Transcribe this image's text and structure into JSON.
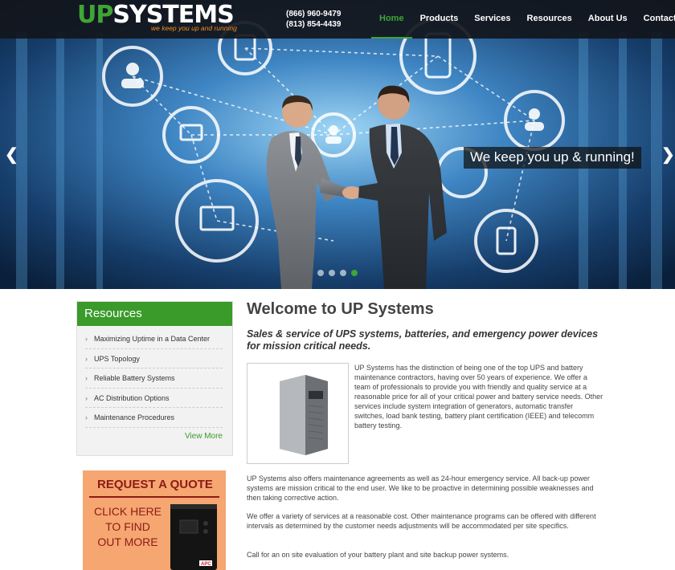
{
  "brand": {
    "logo_up": "UP",
    "logo_systems": "SYSTEMS",
    "tagline": "we keep you up and running",
    "green": "#3fa535",
    "orange": "#f28c1c"
  },
  "contact": {
    "phone1": "(866) 960-9479",
    "phone2": "(813) 854-4439"
  },
  "nav": {
    "items": [
      {
        "label": "Home",
        "active": true
      },
      {
        "label": "Products",
        "active": false
      },
      {
        "label": "Services",
        "active": false
      },
      {
        "label": "Resources",
        "active": false
      },
      {
        "label": "About Us",
        "active": false
      },
      {
        "label": "Contact",
        "active": false
      }
    ]
  },
  "hero": {
    "caption": "We keep you up & running!",
    "prev_icon": "chevron-left-icon",
    "next_icon": "chevron-right-icon",
    "prev_glyph": "❮",
    "next_glyph": "❯",
    "slide_count": 4,
    "active_slide": 4
  },
  "sidebar": {
    "title": "Resources",
    "bullet": "›",
    "items": [
      "Maximizing Uptime in a Data Center",
      "UPS Topology",
      "Reliable Battery Systems",
      "AC Distribution Options",
      "Maintenance Procedures"
    ],
    "view_more": "View More"
  },
  "quote_banner": {
    "title": "REQUEST A QUOTE",
    "line1": "CLICK HERE",
    "line2": "TO FIND",
    "line3": "OUT MORE",
    "device_brand": "APC"
  },
  "main": {
    "title": "Welcome to UP Systems",
    "subtitle": "Sales & service of UPS systems, batteries, and emergency power devices for mission critical needs.",
    "para1": "UP Systems has the distinction of being one of the top UPS and battery maintenance contractors, having over 50 years of experience. We offer a team of professionals to provide you with friendly and quality service at a reasonable price for all of your critical power and battery service needs. Other services include system integration of generators, automatic transfer switches, load bank testing, battery plant certification (IEEE) and telecomm battery testing.",
    "para2": "UP Systems also offers maintenance agreements as well as 24-hour emergency service. All back-up power systems are mission critical to the end user. We like to be proactive in determining possible weaknesses and then taking corrective action.",
    "para3": "We offer a variety of services at a reasonable cost. Other maintenance programs can be offered with different intervals as determined by the customer needs adjustments will be accommodated per site specifics.",
    "para4": "Call for an on site evaluation of your battery plant and site backup power systems."
  }
}
